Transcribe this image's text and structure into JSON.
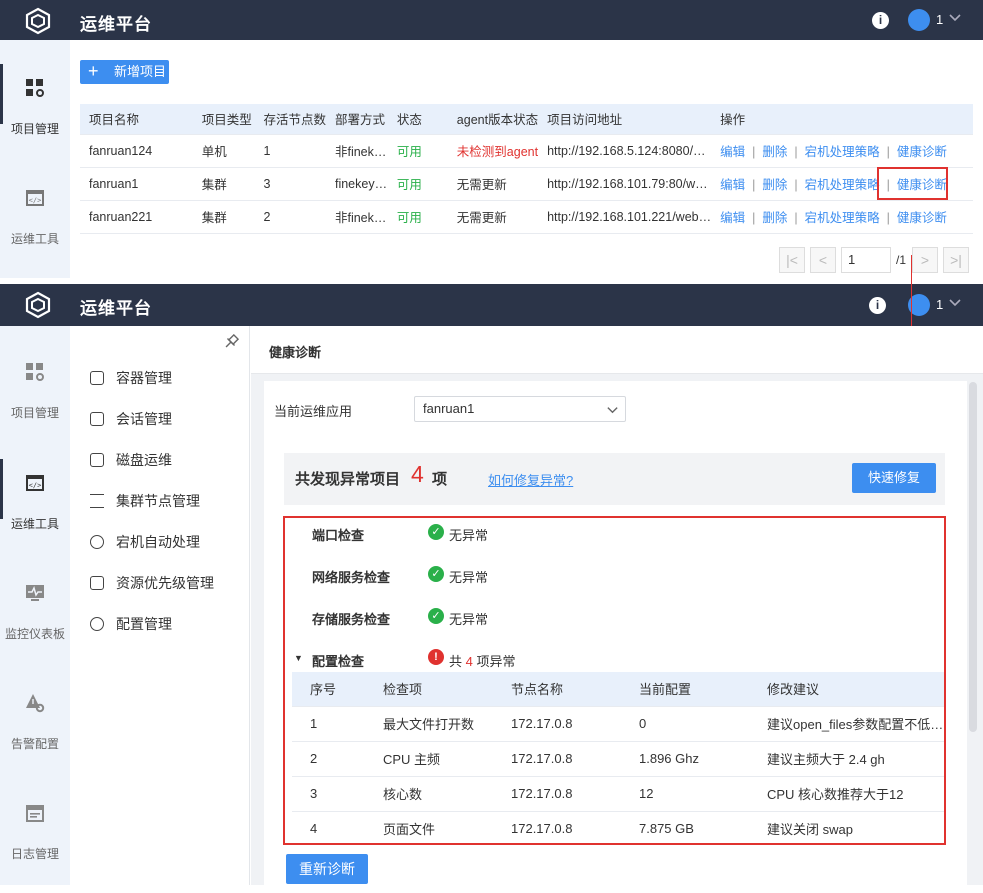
{
  "app": {
    "title": "运维平台",
    "user": "1"
  },
  "colors": {
    "topbar": "#2b3448",
    "accent": "#3d8ef0",
    "ok": "#2ab04a",
    "error": "#e0322f"
  },
  "screen1": {
    "nav": [
      {
        "label": "项目管理",
        "icon": "grid-icon"
      },
      {
        "label": "运维工具",
        "icon": "code-window-icon"
      }
    ],
    "add_button": "新增项目",
    "table": {
      "headers": [
        "项目名称",
        "项目类型",
        "存活节点数",
        "部署方式",
        "状态",
        "agent版本状态",
        "项目访问地址",
        "操作"
      ],
      "rows": [
        {
          "name": "fanruan124",
          "type": "单机",
          "nodes": "1",
          "deploy": "非finek…",
          "status": "可用",
          "agent": "未检测到agent",
          "url": "http://192.168.5.124:8080/…"
        },
        {
          "name": "fanruan1",
          "type": "集群",
          "nodes": "3",
          "deploy": "finekey…",
          "status": "可用",
          "agent": "无需更新",
          "url": "http://192.168.101.79:80/w…"
        },
        {
          "name": "fanruan221",
          "type": "集群",
          "nodes": "2",
          "deploy": "非finek…",
          "status": "可用",
          "agent": "无需更新",
          "url": "http://192.168.101.221/web…"
        }
      ],
      "actions": [
        "编辑",
        "删除",
        "宕机处理策略",
        "健康诊断"
      ]
    },
    "pager": {
      "page": "1",
      "total": "/1"
    }
  },
  "screen2": {
    "nav": [
      {
        "label": "项目管理",
        "icon": "grid-icon"
      },
      {
        "label": "运维工具",
        "icon": "code-window-icon"
      },
      {
        "label": "监控仪表板",
        "icon": "monitor-icon"
      },
      {
        "label": "告警配置",
        "icon": "alert-gear-icon"
      },
      {
        "label": "日志管理",
        "icon": "calendar-icon"
      }
    ],
    "submenu": [
      "容器管理",
      "会话管理",
      "磁盘运维",
      "集群节点管理",
      "宕机自动处理",
      "资源优先级管理",
      "配置管理"
    ],
    "page_title": "健康诊断",
    "app_label": "当前运维应用",
    "app_value": "fanruan1",
    "summary": {
      "prefix": "共发现异常项目",
      "count": "4",
      "suffix": "项",
      "help_link": "如何修复异常?",
      "fix_button": "快速修复"
    },
    "checks": [
      {
        "name": "端口检查",
        "result": "无异常"
      },
      {
        "name": "网络服务检查",
        "result": "无异常"
      },
      {
        "name": "存储服务检查",
        "result": "无异常"
      }
    ],
    "config_check": {
      "name": "配置检查",
      "prefix": "共",
      "count": "4",
      "suffix": "项异常"
    },
    "error_table": {
      "headers": [
        "序号",
        "检查项",
        "节点名称",
        "当前配置",
        "修改建议"
      ],
      "rows": [
        [
          "1",
          "最大文件打开数",
          "172.17.0.8",
          "0",
          "建议open_files参数配置不低…"
        ],
        [
          "2",
          "CPU 主频",
          "172.17.0.8",
          "1.896 Ghz",
          "建议主频大于 2.4 gh"
        ],
        [
          "3",
          "核心数",
          "172.17.0.8",
          "12",
          "CPU 核心数推荐大于12"
        ],
        [
          "4",
          "页面文件",
          "172.17.0.8",
          "7.875 GB",
          "建议关闭 swap"
        ]
      ]
    },
    "rediagnose_button": "重新诊断"
  }
}
